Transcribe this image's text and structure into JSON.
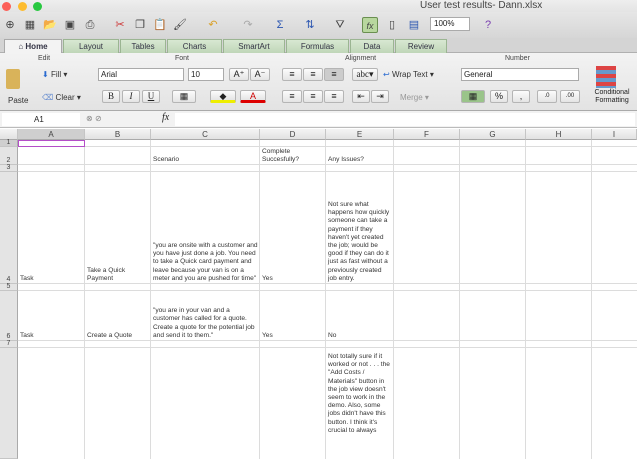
{
  "window": {
    "title": "User test results- Dann.xlsx"
  },
  "toolbar": {
    "zoom": "100%",
    "fx": "fx"
  },
  "tabs": [
    "Home",
    "Layout",
    "Tables",
    "Charts",
    "SmartArt",
    "Formulas",
    "Data",
    "Review"
  ],
  "ribbon": {
    "groups": {
      "edit": "Edit",
      "font": "Font",
      "alignment": "Alignment",
      "number": "Number"
    },
    "paste": "Paste",
    "fill": "Fill",
    "clear": "Clear",
    "font_name": "Arial",
    "font_size": "10",
    "bold": "B",
    "italic": "I",
    "underline": "U",
    "wrap_text": "Wrap Text",
    "merge": "Merge",
    "abc": "abc",
    "number_format": "General",
    "percent": "%",
    "comma": ",",
    "conditional_formatting": "Conditional Formatting"
  },
  "formula_bar": {
    "name_box": "A1",
    "fx": "fx",
    "value": ""
  },
  "columns": [
    "A",
    "B",
    "C",
    "D",
    "E",
    "F",
    "G",
    "H",
    "I"
  ],
  "rows": [
    "1",
    "2",
    "3",
    "4",
    "5",
    "6",
    "7",
    ""
  ],
  "cells": {
    "D2": "Complete Succesfully?",
    "C2": "Scenario",
    "E2": "Any Issues?",
    "A4": "Task",
    "B4": "Take a Quick Payment",
    "C4": "\"you are onsite with a customer and you have just done a job. You need to take a Quick card payment and leave because your van is on a meter and you are pushed for time\"",
    "D4": "Yes",
    "E4": "Not sure what happens how quickly someone can take a payment if they haven't yet created the job; would be good if they can do it just as fast without a previously created job entry.",
    "A6": "Task",
    "B6": "Create a Quote",
    "C6": "\"you are in your van and a customer has called for a quote. Create a quote for the potential job and send it to them.\"",
    "D6": "Yes",
    "E6": "No",
    "E8": "Not totally sure if it worked or not . . . the \"Add Costs / Materials\" button in the job view doesn't seem to work in the demo. Also, some jobs didn't have this button. I think it's crucial to always"
  }
}
